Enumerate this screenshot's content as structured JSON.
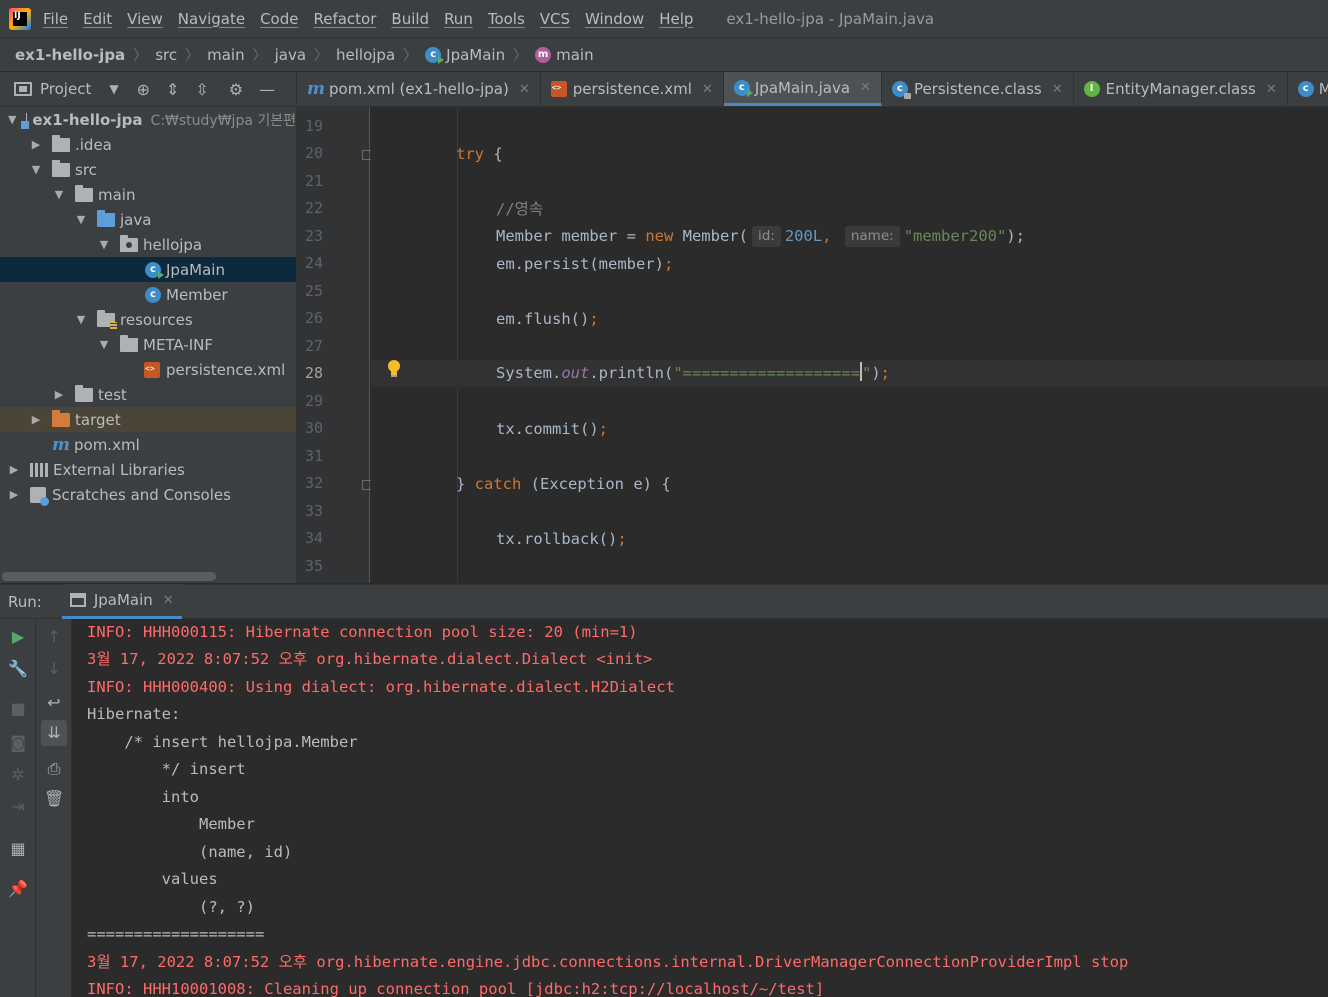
{
  "menubar": {
    "logo": "IJ",
    "items": [
      "File",
      "Edit",
      "View",
      "Navigate",
      "Code",
      "Refactor",
      "Build",
      "Run",
      "Tools",
      "VCS",
      "Window",
      "Help"
    ],
    "window_title": "ex1-hello-jpa - JpaMain.java"
  },
  "breadcrumb": {
    "items": [
      "ex1-hello-jpa",
      "src",
      "main",
      "java",
      "hellojpa",
      "JpaMain",
      "main"
    ]
  },
  "project": {
    "title": "Project",
    "tree": [
      {
        "label": "ex1-hello-jpa",
        "hint": "C:₩study₩jpa 기본편"
      },
      {
        "label": ".idea"
      },
      {
        "label": "src"
      },
      {
        "label": "main"
      },
      {
        "label": "java"
      },
      {
        "label": "hellojpa"
      },
      {
        "label": "JpaMain"
      },
      {
        "label": "Member"
      },
      {
        "label": "resources"
      },
      {
        "label": "META-INF"
      },
      {
        "label": "persistence.xml"
      },
      {
        "label": "test"
      },
      {
        "label": "target"
      },
      {
        "label": "pom.xml"
      },
      {
        "label": "External Libraries"
      },
      {
        "label": "Scratches and Consoles"
      }
    ]
  },
  "editor": {
    "tabs": [
      {
        "label": "pom.xml (ex1-hello-jpa)",
        "active": false
      },
      {
        "label": "persistence.xml",
        "active": false
      },
      {
        "label": "JpaMain.java",
        "active": true
      },
      {
        "label": "Persistence.class",
        "active": false
      },
      {
        "label": "EntityManager.class",
        "active": false
      },
      {
        "label": "Member.java",
        "active": false
      }
    ],
    "current_line": 28,
    "lines": [
      {
        "no": "19"
      },
      {
        "no": "20",
        "kw": "try",
        "rest": " {"
      },
      {
        "no": "21"
      },
      {
        "no": "22",
        "comment": "//영속"
      },
      {
        "no": "23",
        "a": "Member member = ",
        "kw": "new",
        "b": " Member(",
        "hint1": "id:",
        "num": "200L",
        "c": ", ",
        "hint2": "name:",
        "str": "\"member200\"",
        "d": ");"
      },
      {
        "no": "24",
        "a": "em.persist(member)",
        "semi": ";"
      },
      {
        "no": "25"
      },
      {
        "no": "26",
        "a": "em.flush()",
        "semi": ";"
      },
      {
        "no": "27"
      },
      {
        "no": "28",
        "a": "System.",
        "field": "out",
        "b": ".println(",
        "str": "\"===================",
        "str_end": "\"",
        "c": ")",
        "semi": ";"
      },
      {
        "no": "29"
      },
      {
        "no": "30",
        "a": "tx.commit()",
        "semi": ";"
      },
      {
        "no": "31"
      },
      {
        "no": "32",
        "a": "} ",
        "kw": "catch",
        "b": " (Exception e) {"
      },
      {
        "no": "33"
      },
      {
        "no": "34",
        "a": "tx.rollback()",
        "semi": ";"
      },
      {
        "no": "35"
      }
    ]
  },
  "run": {
    "label": "Run:",
    "tab": "JpaMain",
    "console": [
      {
        "text": "INFO: HHH000115: Hibernate connection pool size: 20 (min=1)",
        "err": true
      },
      {
        "text": "3월 17, 2022 8:07:52 오후 org.hibernate.dialect.Dialect <init>",
        "err": true
      },
      {
        "text": "INFO: HHH000400: Using dialect: org.hibernate.dialect.H2Dialect",
        "err": true
      },
      {
        "text": "Hibernate: ",
        "err": false
      },
      {
        "text": "    /* insert hellojpa.Member",
        "err": false
      },
      {
        "text": "        */ insert ",
        "err": false
      },
      {
        "text": "        into",
        "err": false
      },
      {
        "text": "            Member",
        "err": false
      },
      {
        "text": "            (name, id) ",
        "err": false
      },
      {
        "text": "        values",
        "err": false
      },
      {
        "text": "            (?, ?)",
        "err": false
      },
      {
        "text": "===================",
        "err": false
      },
      {
        "text": "3월 17, 2022 8:07:52 오후 org.hibernate.engine.jdbc.connections.internal.DriverManagerConnectionProviderImpl stop",
        "err": true
      },
      {
        "text": "INFO: HHH10001008: Cleaning up connection pool [jdbc:h2:tcp://localhost/~/test]",
        "err": true
      }
    ]
  },
  "colors": {
    "keyword": "#cc7832",
    "string": "#6a8759",
    "number": "#6897bb",
    "error_text": "#ff6b68",
    "selection": "#0d293e",
    "accent": "#4a88c7"
  }
}
